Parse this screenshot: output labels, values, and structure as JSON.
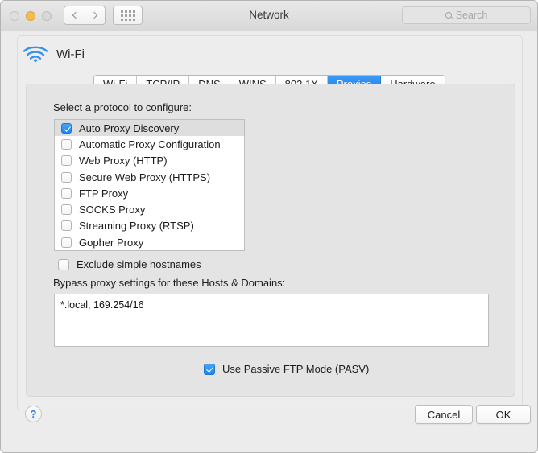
{
  "window": {
    "title": "Network",
    "traffic_lights": [
      {
        "name": "close",
        "color": "#dedede"
      },
      {
        "name": "minimize",
        "color": "#f6bc4f"
      },
      {
        "name": "maximize",
        "color": "#d8d8d8"
      }
    ],
    "nav_back_icon": "chevron-left-icon",
    "nav_forward_icon": "chevron-right-icon",
    "grid_icon": "show-all-grid-icon"
  },
  "search": {
    "placeholder": "Search",
    "icon": "search-icon",
    "value": ""
  },
  "service": {
    "name": "Wi-Fi",
    "icon": "wifi-icon",
    "icon_color": "#2f8ee8"
  },
  "tabs": [
    {
      "label": "Wi-Fi",
      "active": false
    },
    {
      "label": "TCP/IP",
      "active": false
    },
    {
      "label": "DNS",
      "active": false
    },
    {
      "label": "WINS",
      "active": false
    },
    {
      "label": "802.1X",
      "active": false
    },
    {
      "label": "Proxies",
      "active": true
    },
    {
      "label": "Hardware",
      "active": false
    }
  ],
  "accent_color": "#1e86ef",
  "proxies": {
    "protocol_label": "Select a protocol to configure:",
    "protocols": [
      {
        "label": "Auto Proxy Discovery",
        "checked": true,
        "selected": true
      },
      {
        "label": "Automatic Proxy Configuration",
        "checked": false,
        "selected": false
      },
      {
        "label": "Web Proxy (HTTP)",
        "checked": false,
        "selected": false
      },
      {
        "label": "Secure Web Proxy (HTTPS)",
        "checked": false,
        "selected": false
      },
      {
        "label": "FTP Proxy",
        "checked": false,
        "selected": false
      },
      {
        "label": "SOCKS Proxy",
        "checked": false,
        "selected": false
      },
      {
        "label": "Streaming Proxy (RTSP)",
        "checked": false,
        "selected": false
      },
      {
        "label": "Gopher Proxy",
        "checked": false,
        "selected": false
      }
    ],
    "exclude_simple_hostnames": {
      "label": "Exclude simple hostnames",
      "checked": false
    },
    "bypass_label": "Bypass proxy settings for these Hosts & Domains:",
    "bypass_value": "*.local, 169.254/16",
    "passive_ftp": {
      "label": "Use Passive FTP Mode (PASV)",
      "checked": true
    }
  },
  "footer": {
    "help_label": "?",
    "cancel_label": "Cancel",
    "ok_label": "OK"
  }
}
